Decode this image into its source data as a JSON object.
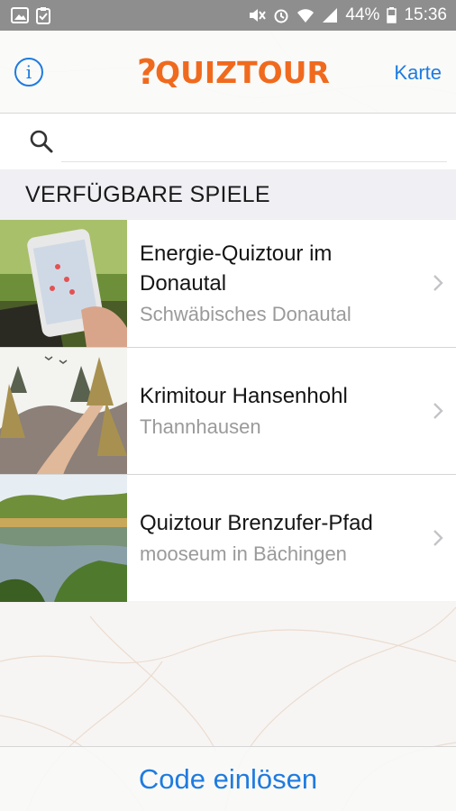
{
  "status_bar": {
    "battery_percent": "44%",
    "time": "15:36"
  },
  "nav": {
    "logo_mark": "?",
    "logo_text": "QUIZTOUR",
    "right_button": "Karte",
    "info_glyph": "i"
  },
  "search": {
    "placeholder": "",
    "value": ""
  },
  "section": {
    "title": "VERFÜGBARE SPIELE"
  },
  "games": [
    {
      "title": "Energie-Quiztour im Donautal",
      "subtitle": "Schwäbisches Donautal"
    },
    {
      "title": "Krimitour Hansenhohl",
      "subtitle": "Thannhausen"
    },
    {
      "title": "Quiztour Brenzufer-Pfad",
      "subtitle": "mooseum in Bächingen"
    }
  ],
  "footer": {
    "button": "Code einlösen"
  },
  "colors": {
    "accent": "#1e7be0",
    "brand": "#f06a1e",
    "status_bar": "#8e8e8e"
  }
}
